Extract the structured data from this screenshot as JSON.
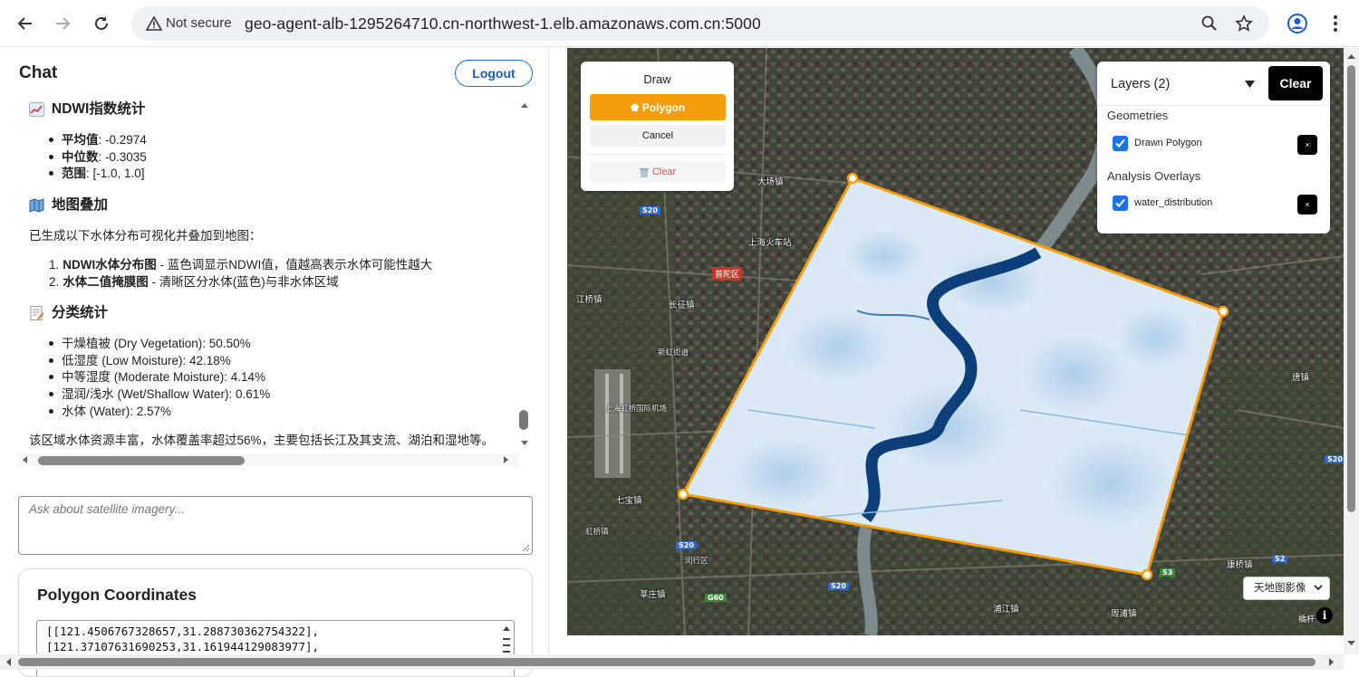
{
  "browser": {
    "security_label": "Not secure",
    "url": "geo-agent-alb-1295264710.cn-northwest-1.elb.amazonaws.com.cn:5000"
  },
  "chat": {
    "title": "Chat",
    "logout_label": "Logout",
    "sections": {
      "ndwi_title": "NDWI指数统计",
      "ndwi_stats": [
        {
          "label": "平均值",
          "value": ": -0.2974"
        },
        {
          "label": "中位数",
          "value": ": -0.3035"
        },
        {
          "label": "范围",
          "value": ": [-1.0, 1.0]"
        }
      ],
      "overlay_title": "地图叠加",
      "overlay_intro": "已生成以下水体分布可视化并叠加到地图：",
      "overlay_items": [
        {
          "num": "1.",
          "label": "NDWI水体分布图",
          "desc": " - 蓝色调显示NDWI值，值越高表示水体可能性越大"
        },
        {
          "num": "2.",
          "label": "水体二值掩膜图",
          "desc": " - 清晰区分水体(蓝色)与非水体区域"
        }
      ],
      "class_title": "分类统计",
      "class_items": [
        "干燥植被 (Dry Vegetation): 50.50%",
        "低湿度 (Low Moisture): 42.18%",
        "中等湿度 (Moderate Moisture): 4.14%",
        "湿润/浅水 (Wet/Shallow Water): 0.61%",
        "水体 (Water): 2.57%"
      ],
      "summary": "该区域水体资源丰富，水体覆盖率超过56%，主要包括长江及其支流、湖泊和湿地等。"
    },
    "input_placeholder": "Ask about satellite imagery..."
  },
  "coords": {
    "title": "Polygon Coordinates",
    "lines": [
      "[[121.4506767328657,31.288730362754322],",
      "[121.37107631690253,31.161944129083977],"
    ]
  },
  "draw": {
    "title": "Draw",
    "polygon_label": "Polygon",
    "cancel_label": "Cancel",
    "clear_label": "Clear"
  },
  "layers": {
    "title": "Layers (2)",
    "clear_label": "Clear",
    "geometries_label": "Geometries",
    "geometry_item": "Drawn Polygon",
    "overlays_label": "Analysis Overlays",
    "overlay_item": "water_distribution",
    "remove_label": "×"
  },
  "map": {
    "basemap_label": "天地图影像",
    "info_label": "i",
    "attribution": "橋杆",
    "colors": {
      "polygon_outline": "#f59e0b",
      "water_dark": "#0d3f7a",
      "water_light": "#dbe9f6"
    },
    "labels": [
      "长征镇",
      "普陀区",
      "江桥镇",
      "上海火车站",
      "大场镇",
      "七宝镇",
      "莘庄镇",
      "康桥镇",
      "周浦镇",
      "唐镇",
      "上海虹桥国际机场",
      "新虹街道",
      "虹桥镇",
      "浦江镇",
      "闵行区"
    ],
    "road_badges": [
      "S20",
      "S20",
      "S20",
      "G60",
      "S2",
      "S3",
      "S20"
    ]
  }
}
